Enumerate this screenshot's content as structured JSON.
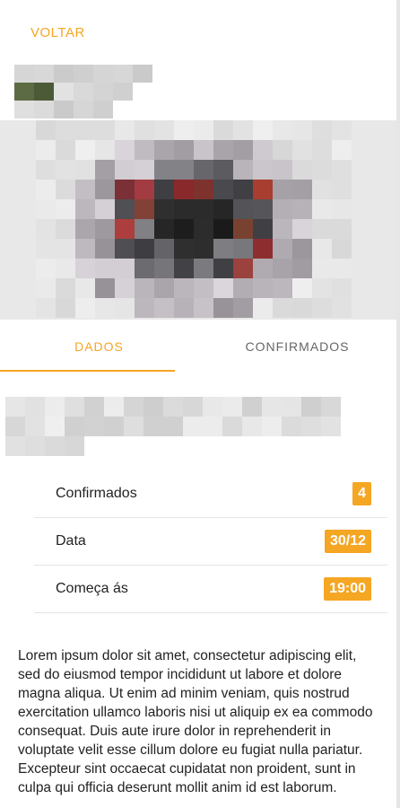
{
  "nav": {
    "back_label": "VOLTAR"
  },
  "tabs": [
    {
      "label": "DADOS",
      "active": true
    },
    {
      "label": "CONFIRMADOS",
      "active": false
    }
  ],
  "info": {
    "rows": [
      {
        "label": "Confirmados",
        "value": "4"
      },
      {
        "label": "Data",
        "value": "30/12"
      },
      {
        "label": "Começa ás",
        "value": "19:00"
      }
    ]
  },
  "description": "Lorem ipsum dolor sit amet, consectetur adipiscing elit, sed do eiusmod tempor incididunt ut labore et dolore magna aliqua. Ut enim ad minim veniam, quis nostrud exercitation ullamco laboris nisi ut aliquip ex ea commodo consequat. Duis aute irure dolor in reprehenderit in voluptate velit esse cillum dolore eu fugiat nulla pariatur. Excepteur sint occaecat cupidatat non proident, sunt in culpa qui officia deserunt mollit anim id est laborum.",
  "colors": {
    "accent": "#f5a623",
    "text": "#222222",
    "muted": "#666666",
    "divider": "#e4e4e4"
  },
  "icons": {
    "title": "pixelated-title-image",
    "hero": "pixelated-event-photo",
    "subtitle": "pixelated-subtitle-image"
  }
}
